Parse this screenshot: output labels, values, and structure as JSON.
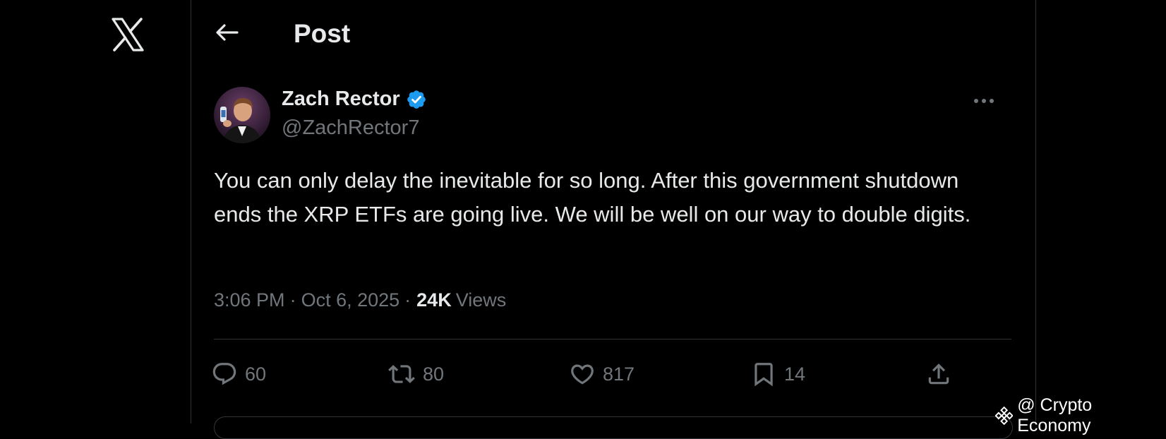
{
  "header": {
    "title": "Post"
  },
  "post": {
    "author": {
      "display_name": "Zach Rector",
      "handle": "@ZachRector7",
      "verified": true
    },
    "text": "You can only delay the inevitable for so long. After this government shutdown ends the XRP ETFs are going live. We will be well on our way to double digits.",
    "time": "3:06 PM",
    "separator": "·",
    "date": "Oct 6, 2025",
    "views_count": "24K",
    "views_label": "Views"
  },
  "actions": {
    "replies": "60",
    "reposts": "80",
    "likes": "817",
    "bookmarks": "14"
  },
  "icons": [
    "x-logo-icon",
    "back-arrow-icon",
    "verified-badge-icon",
    "more-icon",
    "reply-icon",
    "repost-icon",
    "like-icon",
    "bookmark-icon",
    "share-icon",
    "binance-logo-icon"
  ],
  "watermark": {
    "text": "@ Crypto Economy"
  },
  "colors": {
    "background": "#000000",
    "text": "#e7e9ea",
    "secondary": "#71767b",
    "verified": "#1d9bf0",
    "divider": "#2f3336"
  }
}
